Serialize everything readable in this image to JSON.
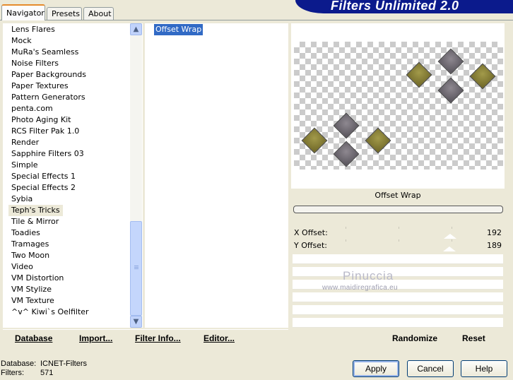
{
  "tabs": [
    {
      "label": "Navigator",
      "active": true
    },
    {
      "label": "Presets",
      "active": false
    },
    {
      "label": "About",
      "active": false
    }
  ],
  "app_title": "Filters Unlimited 2.0",
  "categories": {
    "items": [
      "Lens Flares",
      "Mock",
      "MuRa's Seamless",
      "Noise Filters",
      "Paper Backgrounds",
      "Paper Textures",
      "Pattern Generators",
      "penta.com",
      "Photo Aging Kit",
      "RCS Filter Pak 1.0",
      "Render",
      "Sapphire Filters 03",
      "Simple",
      "Special Effects 1",
      "Special Effects 2",
      "Sybia",
      "Teph's Tricks",
      "Tile & Mirror",
      "Toadies",
      "Tramages",
      "Two Moon",
      "Video",
      "VM Distortion",
      "VM Stylize",
      "VM Texture",
      "^v^ Kiwi`s Oelfilter"
    ],
    "selected": "Teph's Tricks"
  },
  "filters": {
    "items": [
      "Offset Wrap"
    ],
    "selected": "Offset Wrap"
  },
  "preview": {
    "filter_name": "Offset Wrap",
    "progress": 0
  },
  "parameters": [
    {
      "label": "X Offset:",
      "value": "192"
    },
    {
      "label": "Y Offset:",
      "value": "189"
    }
  ],
  "watermark": {
    "name": "Pinuccia",
    "url": "www.maidiregrafica.eu"
  },
  "bottom_menu": {
    "database": "Database",
    "import": "Import...",
    "filter_info": "Filter Info...",
    "editor": "Editor...",
    "randomize": "Randomize",
    "reset": "Reset"
  },
  "status": {
    "database_label": "Database:",
    "database_value": "ICNET-Filters",
    "filters_label": "Filters:",
    "filters_value": "571"
  },
  "buttons": {
    "apply": "Apply",
    "cancel": "Cancel",
    "help": "Help"
  },
  "colors": {
    "banner": "#0b1a8c",
    "selection": "#316ac5",
    "diamond_olive": "#8a8234",
    "diamond_grey": "#6e6a72"
  }
}
